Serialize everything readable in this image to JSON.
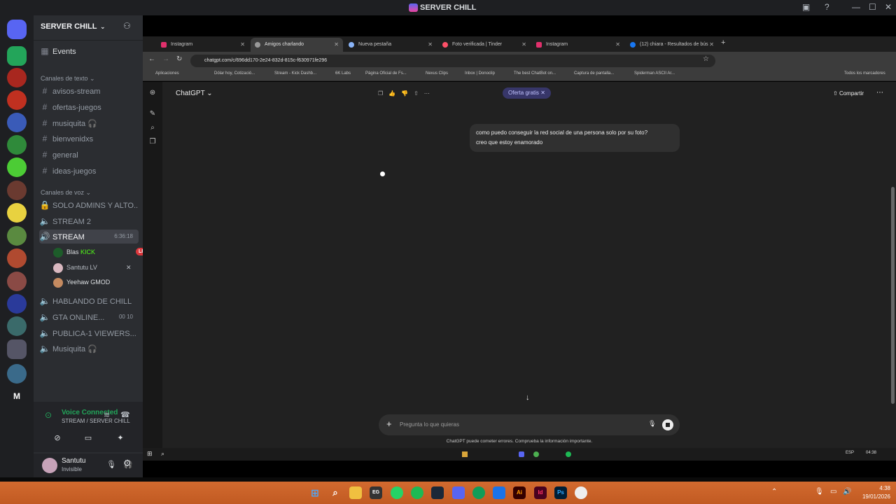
{
  "app": {
    "title": "SERVER CHILL"
  },
  "server": {
    "name": "SERVER CHILL",
    "events_label": "Events",
    "text_category": "Canales de texto",
    "text_channels": [
      "avisos-stream",
      "ofertas-juegos",
      "musiquita 🎧",
      "bienvenidxs",
      "general",
      "ideas-juegos"
    ],
    "voice_category": "Canales de voz",
    "voice_channels": {
      "admins": "SOLO ADMINS Y ALTO...",
      "stream2": "STREAM 2",
      "stream": "STREAM",
      "stream_timer": "6:36:18",
      "hablando": "HABLANDO DE CHILL",
      "gta": "GTA ONLINE...",
      "gta_count": "00 10",
      "publica": "PUBLICA-1 VIEWERS...",
      "musiquita": "Musiquita 🎧"
    },
    "members": [
      {
        "name": "Blas",
        "tag": "KICK",
        "badge": "LIVE"
      },
      {
        "name": "Santutu",
        "tag": "LV"
      },
      {
        "name": "Yeehaw",
        "tag": "GMOD"
      }
    ]
  },
  "voice": {
    "status": "Voice Connected",
    "location": "STREAM / SERVER CHILL"
  },
  "user": {
    "name": "Santutu",
    "status": "Invisible"
  },
  "browser": {
    "tabs": [
      "Instagram",
      "Amigos charlando",
      "Nueva pestaña",
      "Foto verificada | Tinder",
      "Instagram",
      "(12) chiara - Resultados de bús"
    ],
    "url": "chatgpt.com/c/696dd170-2e24-832d-815c-f630971fe296",
    "bookmarks": [
      "Aplicaciones",
      "Dólar hoy, Cotizació...",
      "Stream - Kick Dashb...",
      "6K Labs",
      "Página Oficial de Fs...",
      "Nexus Clips",
      "Inbox | Donoclip",
      "The best ChatBot on...",
      "Captura de pantalla...",
      "Spiderman ASCII Ar...",
      "Todos los marcadores"
    ]
  },
  "chatgpt": {
    "title": "ChatGPT",
    "offer": "Oferta gratis",
    "share": "Compartir",
    "message_line1": "como puedo conseguir la red social de una persona solo por su foto?",
    "message_line2": "creo que estoy enamorado",
    "composer_placeholder": "Pregunta lo que quieras",
    "disclaimer": "ChatGPT puede cometer errores. Comprueba la información importante."
  },
  "inner_taskbar": {
    "lang": "ESP",
    "time": "04:38"
  },
  "taskbar": {
    "time": "4:38",
    "date": "19/01/2026"
  },
  "colors": {
    "discord_bg": "#2b2d31",
    "rail_bg": "#1e1f22",
    "taskbar": "#c9602a",
    "live": "#da373c",
    "voice_green": "#23a55a"
  }
}
